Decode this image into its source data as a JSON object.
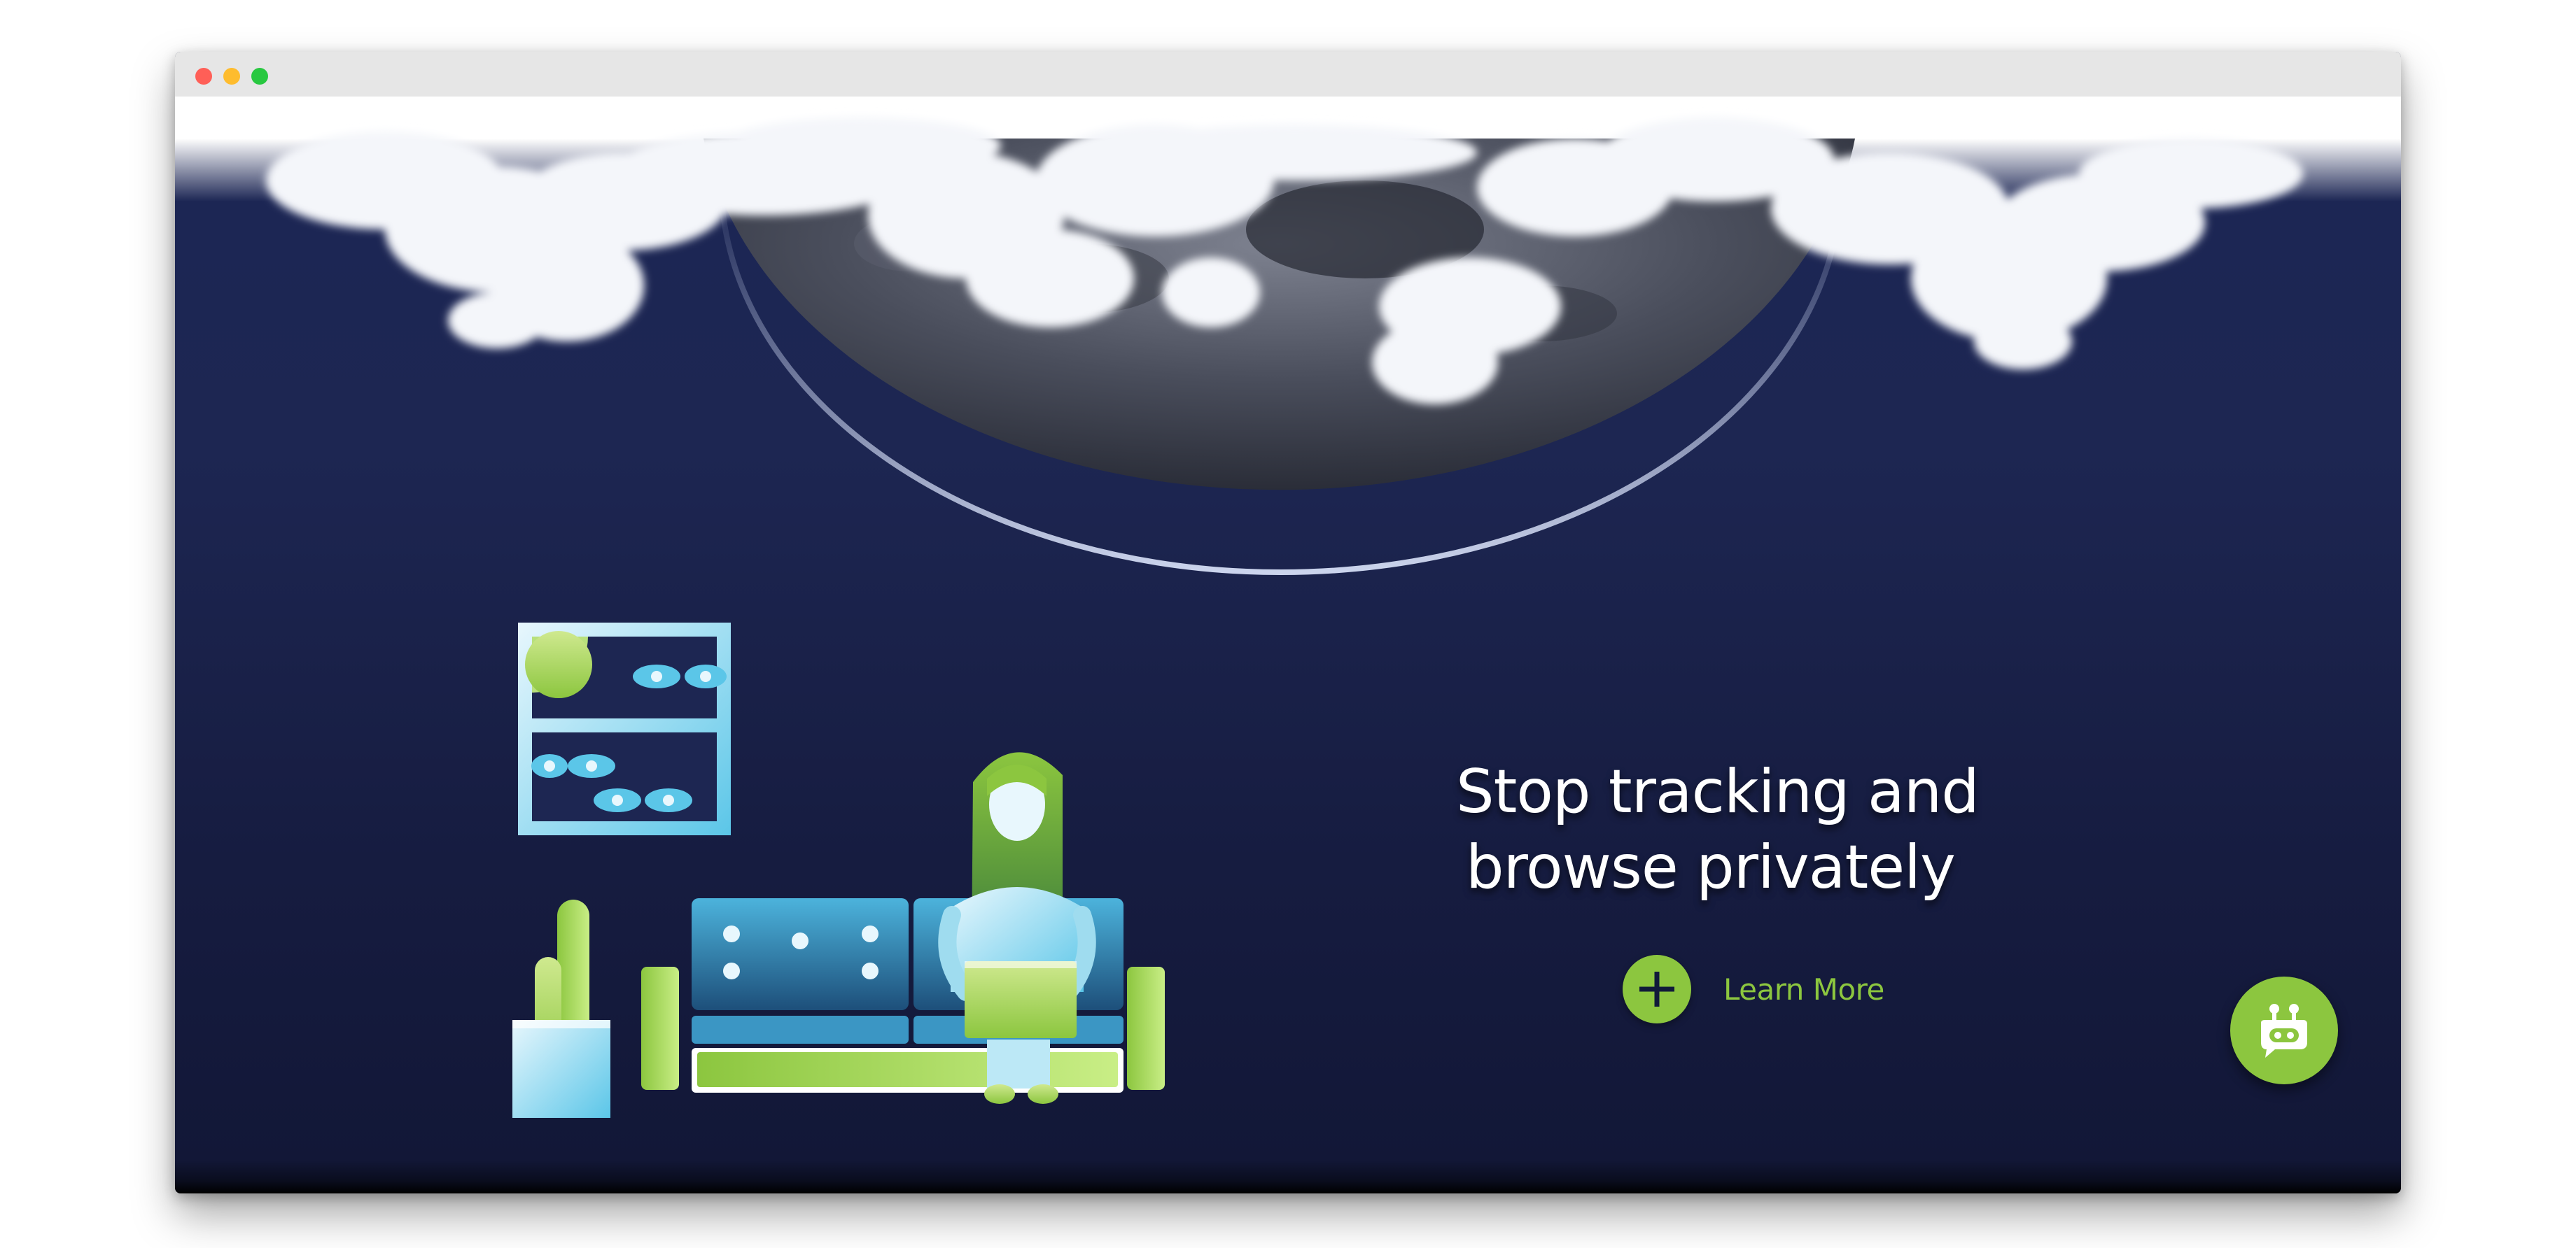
{
  "window": {
    "traffic_lights": [
      "#ff5f57",
      "#febc2e",
      "#28c840"
    ]
  },
  "hero": {
    "title_line1": "Stop tracking and",
    "title_line2": "browse privately",
    "cta_label": "Learn More"
  },
  "icons": {
    "cta": "plus-icon",
    "chat": "chatbot-icon"
  },
  "colors": {
    "accent": "#8cc63f",
    "background": "#1c2452",
    "cyan": "#5bc6e8",
    "text": "#ffffff"
  }
}
